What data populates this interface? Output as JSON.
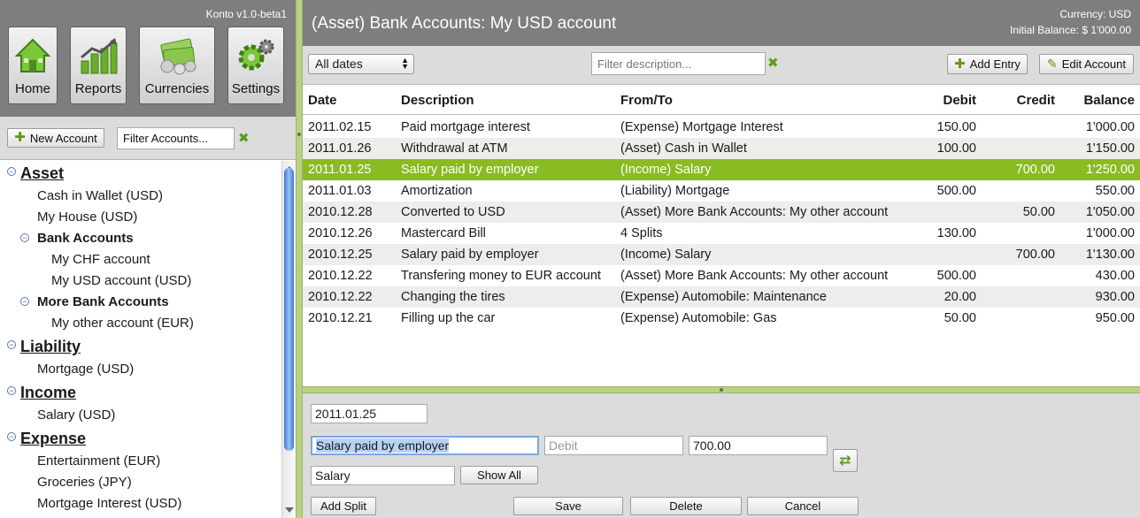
{
  "app": {
    "version": "Konto v1.0-beta1"
  },
  "nav": {
    "home": "Home",
    "reports": "Reports",
    "currencies": "Currencies",
    "settings": "Settings"
  },
  "accounts_toolbar": {
    "new_account": "New Account",
    "filter_placeholder": "Filter Accounts..."
  },
  "tree": {
    "asset": "Asset",
    "cash_wallet": "Cash in Wallet (USD)",
    "my_house": "My House (USD)",
    "bank_accounts": "Bank Accounts",
    "chf_account": "My CHF account",
    "usd_account": "My USD account (USD)",
    "more_bank_accounts": "More Bank Accounts",
    "other_account": "My other account (EUR)",
    "liability": "Liability",
    "mortgage": "Mortgage (USD)",
    "income": "Income",
    "salary": "Salary (USD)",
    "expense": "Expense",
    "entertainment": "Entertainment (EUR)",
    "groceries": "Groceries (JPY)",
    "mortgage_interest": "Mortgage Interest (USD)"
  },
  "account_header": {
    "title": "(Asset) Bank Accounts: My USD account",
    "currency": "Currency: USD",
    "initial_balance": "Initial Balance: $ 1'000.00"
  },
  "toolbar": {
    "date_filter": "All dates",
    "filter_placeholder": "Filter description...",
    "add_entry": "Add Entry",
    "edit_account": "Edit Account"
  },
  "table": {
    "headers": {
      "date": "Date",
      "description": "Description",
      "from_to": "From/To",
      "debit": "Debit",
      "credit": "Credit",
      "balance": "Balance"
    },
    "rows": [
      {
        "date": "2011.02.15",
        "description": "Paid mortgage interest",
        "from_to": "(Expense) Mortgage Interest",
        "debit": "150.00",
        "credit": "",
        "balance": "1'000.00"
      },
      {
        "date": "2011.01.26",
        "description": "Withdrawal at ATM",
        "from_to": "(Asset) Cash in Wallet",
        "debit": "100.00",
        "credit": "",
        "balance": "1'150.00"
      },
      {
        "date": "2011.01.25",
        "description": "Salary paid by employer",
        "from_to": "(Income) Salary",
        "debit": "",
        "credit": "700.00",
        "balance": "1'250.00"
      },
      {
        "date": "2011.01.03",
        "description": "Amortization",
        "from_to": "(Liability) Mortgage",
        "debit": "500.00",
        "credit": "",
        "balance": "550.00"
      },
      {
        "date": "2010.12.28",
        "description": "Converted to USD",
        "from_to": "(Asset) More Bank Accounts: My other account",
        "debit": "",
        "credit": "50.00",
        "balance": "1'050.00"
      },
      {
        "date": "2010.12.26",
        "description": "Mastercard Bill",
        "from_to": "4 Splits",
        "debit": "130.00",
        "credit": "",
        "balance": "1'000.00"
      },
      {
        "date": "2010.12.25",
        "description": "Salary paid by employer",
        "from_to": "(Income) Salary",
        "debit": "",
        "credit": "700.00",
        "balance": "1'130.00"
      },
      {
        "date": "2010.12.22",
        "description": "Transfering money to EUR account",
        "from_to": "(Asset) More Bank Accounts: My other account",
        "debit": "500.00",
        "credit": "",
        "balance": "430.00"
      },
      {
        "date": "2010.12.22",
        "description": "Changing the tires",
        "from_to": "(Expense) Automobile: Maintenance",
        "debit": "20.00",
        "credit": "",
        "balance": "930.00"
      },
      {
        "date": "2010.12.21",
        "description": "Filling up the car",
        "from_to": "(Expense) Automobile: Gas",
        "debit": "50.00",
        "credit": "",
        "balance": "950.00"
      }
    ]
  },
  "editor": {
    "date": "2011.01.25",
    "description": "Salary paid by employer",
    "debit_placeholder": "Debit",
    "credit": "700.00",
    "account": "Salary",
    "show_all": "Show All",
    "add_split": "Add Split",
    "save": "Save",
    "delete": "Delete",
    "cancel": "Cancel"
  },
  "colors": {
    "header_gray": "#7e7e7e",
    "toolbar_gray": "#dcdcdc",
    "selection_green": "#8abb23",
    "splitter_green": "#b9d086",
    "accent_green": "#5d9b1a"
  }
}
